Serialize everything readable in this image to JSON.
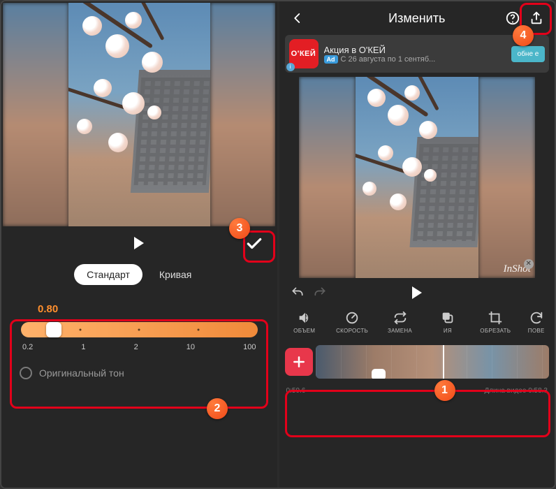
{
  "left": {
    "tabs": {
      "standard": "Стандарт",
      "curve": "Кривая"
    },
    "speed": {
      "value": "0.80",
      "ticks": [
        "0.2",
        "1",
        "2",
        "10",
        "100"
      ],
      "knob_pct": 14
    },
    "original_tone": "Оригинальный тон"
  },
  "right": {
    "title": "Изменить",
    "ad": {
      "logo": "О'КЕЙ",
      "title": "Акция в О'КЕЙ",
      "badge": "Ad",
      "subtitle": "С 26 августа по 1 сентяб...",
      "button": "обне\nе"
    },
    "watermark": "InShot",
    "tools": [
      {
        "id": "volume",
        "label": "ОБЪЕМ"
      },
      {
        "id": "speed",
        "label": "СКОРОСТЬ"
      },
      {
        "id": "replace",
        "label": "ЗАМЕНА"
      },
      {
        "id": "copy",
        "label": "ИЯ"
      },
      {
        "id": "crop",
        "label": "ОБРЕЗАТЬ"
      },
      {
        "id": "rotate",
        "label": "ПОВЕ"
      }
    ],
    "footer": {
      "time": "0:50.6",
      "length": "Длина видео 0:58.3"
    }
  },
  "callouts": {
    "c1": "1",
    "c2": "2",
    "c3": "3",
    "c4": "4"
  }
}
